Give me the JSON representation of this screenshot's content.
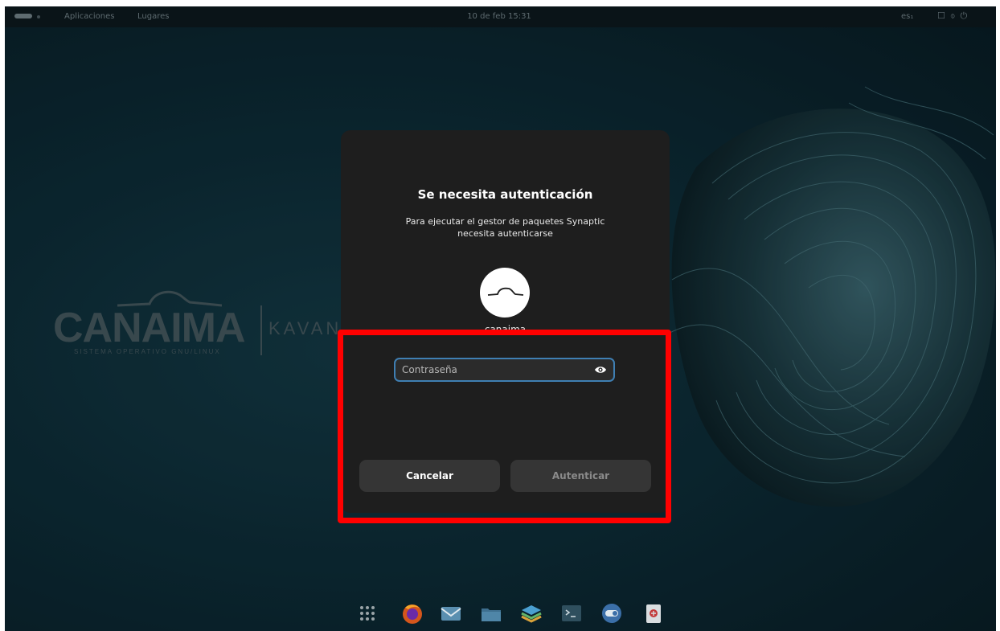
{
  "topbar": {
    "activities_icon": "activities-pill-icon",
    "applications": "Aplicaciones",
    "places": "Lugares",
    "clock": "10 de feb  15:31",
    "language": "es₁",
    "system_icons": [
      "screen-icon",
      "network-icon",
      "power-icon"
    ]
  },
  "wallpaper": {
    "logo_text": "CANAIMA",
    "logo_subtitle": "SISTEMA OPERATIVO GNU/LINUX",
    "logo_edition": "KAVAN"
  },
  "dialog": {
    "title": "Se necesita autenticación",
    "message": "Para ejecutar el gestor de paquetes Synaptic necesita autenticarse",
    "avatar_icon": "canaima-avatar-icon",
    "username": "canaima",
    "password_placeholder": "Contraseña",
    "password_value": "",
    "reveal_icon": "eye-icon",
    "cancel_label": "Cancelar",
    "authenticate_label": "Autenticar"
  },
  "dock": {
    "items": [
      "app-grid-icon",
      "firefox-icon",
      "mail-icon",
      "files-icon",
      "layers-icon",
      "terminal-icon",
      "toggle-icon",
      "trash-icon"
    ]
  },
  "colors": {
    "accent": "#3f7fb3",
    "highlight": "#ff0000",
    "dialog_bg": "#1e1e1e",
    "button_bg": "#353535"
  }
}
